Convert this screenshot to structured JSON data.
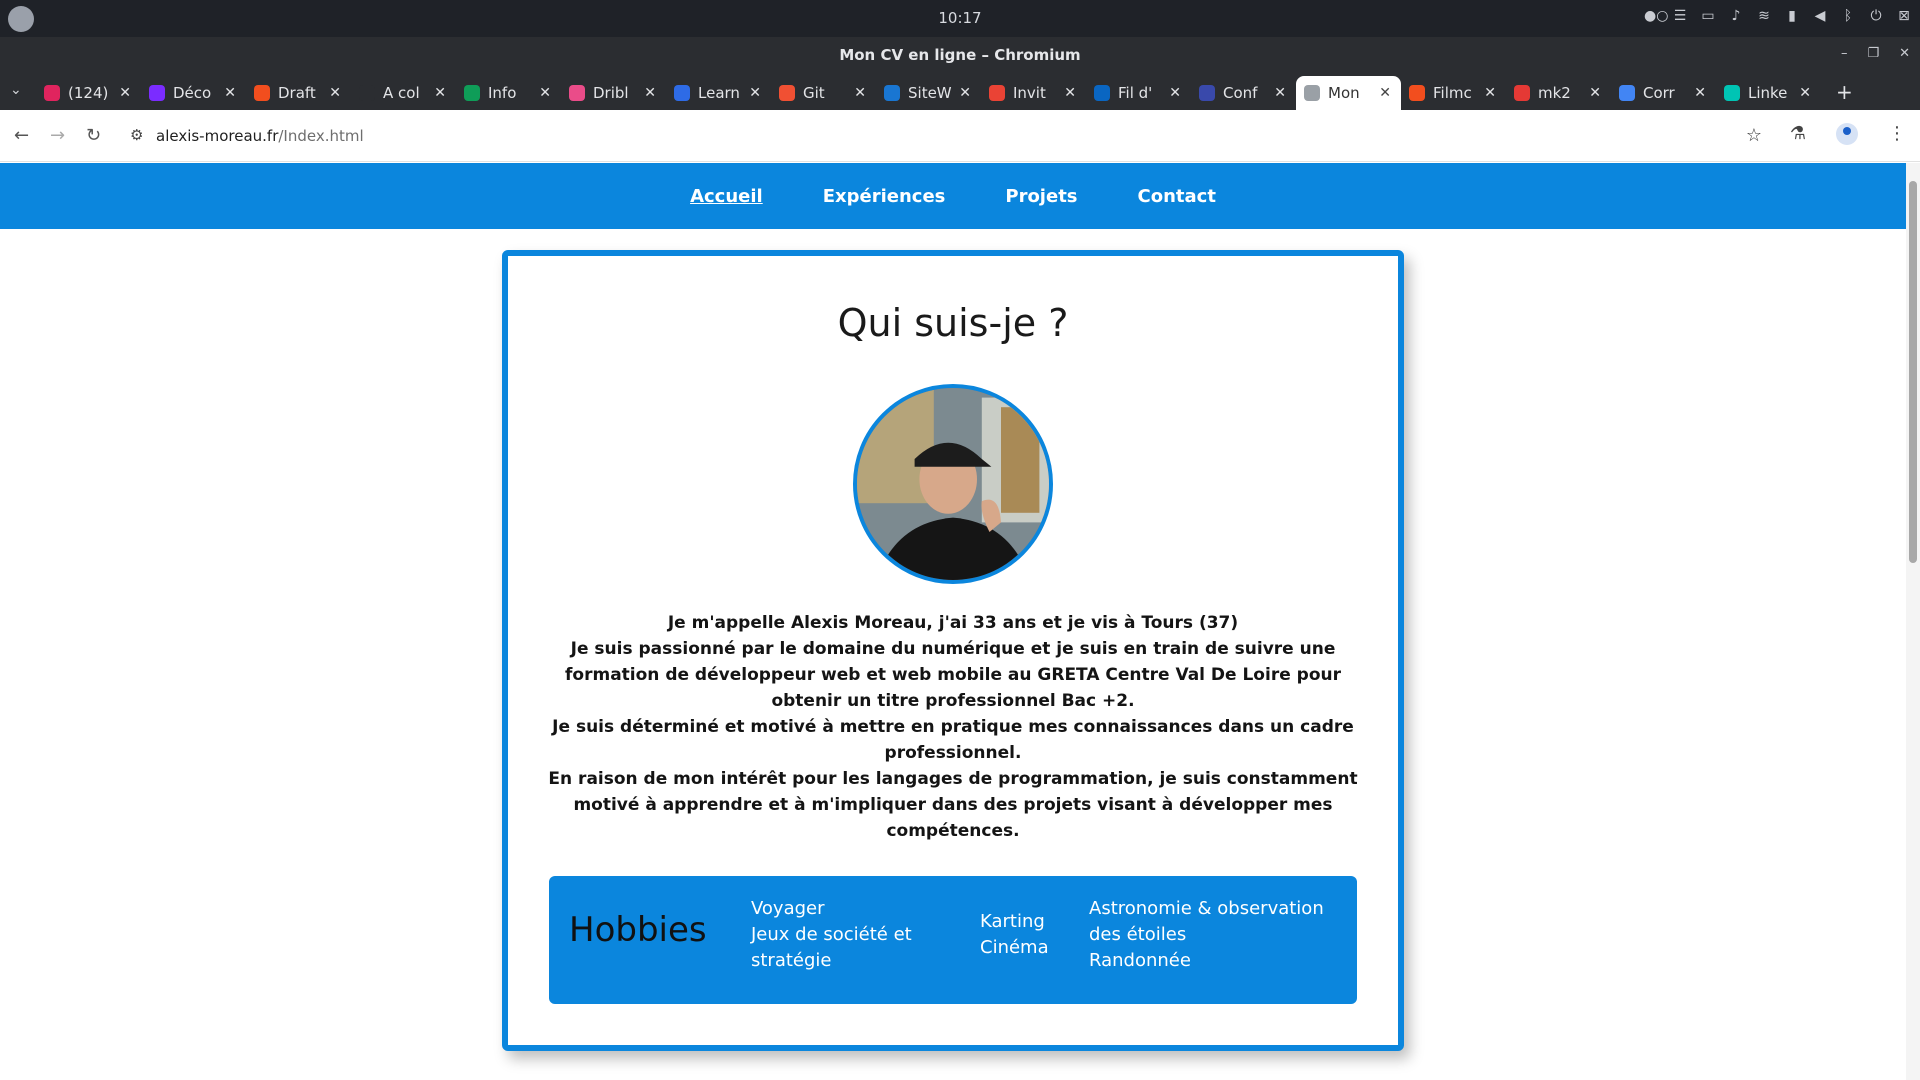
{
  "os": {
    "clock": "10:17"
  },
  "window": {
    "title": "Mon CV en ligne – Chromium"
  },
  "tabs": [
    {
      "label": "(124)",
      "color": "#e0245e"
    },
    {
      "label": "Déco",
      "color": "#7b2cff"
    },
    {
      "label": "Draft",
      "color": "#f24e1e"
    },
    {
      "label": "A col",
      "color": "#2b2d31"
    },
    {
      "label": "Info",
      "color": "#0f9d58"
    },
    {
      "label": "Dribl",
      "color": "#ea4c89"
    },
    {
      "label": "Learn",
      "color": "#2e6be6"
    },
    {
      "label": "Git",
      "color": "#f05033"
    },
    {
      "label": "SiteW",
      "color": "#1976d2"
    },
    {
      "label": "Invit",
      "color": "#ea4335"
    },
    {
      "label": "Fil d'",
      "color": "#0a66c2"
    },
    {
      "label": "Conf",
      "color": "#3949ab"
    },
    {
      "label": "Mon",
      "color": "#9aa0a6",
      "active": true
    },
    {
      "label": "Filmc",
      "color": "#f24e1e"
    },
    {
      "label": "mk2",
      "color": "#e53935"
    },
    {
      "label": "Corr",
      "color": "#4285f4"
    },
    {
      "label": "Linke",
      "color": "#00c4b4"
    }
  ],
  "address": {
    "host": "alexis-moreau.fr",
    "path": "/Index.html"
  },
  "site": {
    "nav": [
      "Accueil",
      "Expériences",
      "Projets",
      "Contact"
    ],
    "heading": "Qui suis-je ?",
    "about": [
      "Je m'appelle Alexis Moreau, j'ai 33 ans et je vis à Tours (37)",
      "Je suis passionné par le domaine du numérique et je suis en train de suivre une formation de développeur web et web mobile au GRETA Centre Val De Loire pour obtenir un titre professionnel Bac +2.",
      "Je suis déterminé et motivé à mettre en pratique mes connaissances dans un cadre professionnel.",
      "En raison de mon intérêt pour les langages de programmation, je suis constamment motivé à apprendre et à m'impliquer dans des projets visant à développer mes compétences."
    ],
    "hobbies": {
      "title": "Hobbies",
      "col1": [
        "Voyager",
        "Jeux de société et stratégie"
      ],
      "col2": [
        "Karting",
        "Cinéma"
      ],
      "col3": [
        "Astronomie & observation des étoiles",
        "Randonnée"
      ]
    }
  },
  "colors": {
    "accent": "#0b86dd"
  }
}
